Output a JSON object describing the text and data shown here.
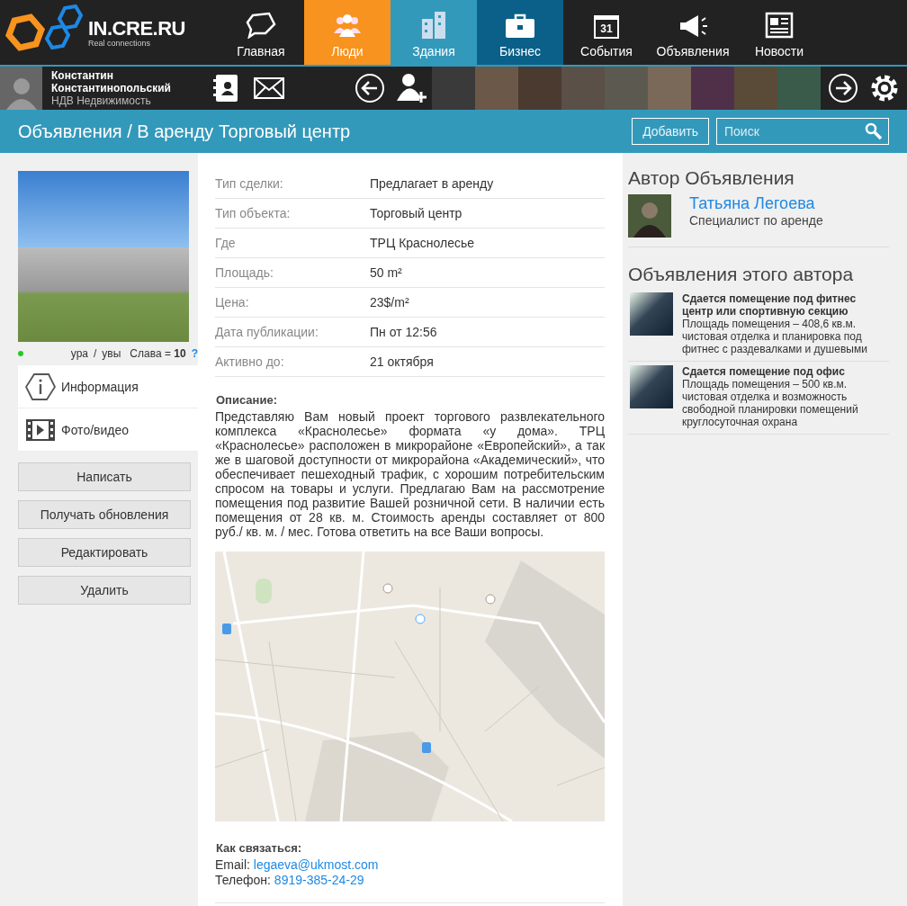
{
  "logo": {
    "name": "IN.CRE.RU",
    "tagline": "Real connections"
  },
  "nav": [
    {
      "label": "Главная",
      "kind": "chat"
    },
    {
      "label": "Люди",
      "kind": "people",
      "color": "#f7931e"
    },
    {
      "label": "Здания",
      "kind": "buildings",
      "color": "#3399bb"
    },
    {
      "label": "Бизнес",
      "kind": "briefcase",
      "color": "#0a6088"
    },
    {
      "label": "События",
      "kind": "calendar",
      "icon_text": "31"
    },
    {
      "label": "Объявления",
      "kind": "megaphone"
    },
    {
      "label": "Новости",
      "kind": "news"
    }
  ],
  "user": {
    "name": "Константин Константинопольский",
    "company": "НДВ Недвижимость"
  },
  "page_title": "Объявления / В аренду Торговый центр",
  "add_button": "Добавить",
  "search": {
    "placeholder": "Поиск"
  },
  "profile": {
    "online": true,
    "vote_up": "ура",
    "vote_separator": "/",
    "vote_down": "увы",
    "rating_label": "Слава =",
    "rating": "10",
    "help": "?"
  },
  "menu": [
    {
      "label": "Информация",
      "kind": "info"
    },
    {
      "label": "Фото/видео",
      "kind": "video"
    }
  ],
  "actions": [
    "Написать",
    "Получать обновления",
    "Редактировать",
    "Удалить"
  ],
  "details": [
    {
      "label": "Тип сделки:",
      "value": "Предлагает в аренду"
    },
    {
      "label": "Тип объекта:",
      "value": "Торговый центр"
    },
    {
      "label": "Где",
      "value": "ТРЦ Краснолесье"
    },
    {
      "label": "Площадь:",
      "value": "50 m²"
    },
    {
      "label": "Цена:",
      "value": "23$/m²"
    },
    {
      "label": "Дата публикации:",
      "value": "Пн от 12:56"
    },
    {
      "label": "Активно до:",
      "value": "21 октября"
    }
  ],
  "description": {
    "heading": "Описание:",
    "text": "Представляю Вам новый проект торгового развлекательного комплекса «Краснолесье» формата «у дома». ТРЦ «Краснолесье» расположен в микрорайоне «Европейский», а так же в шаговой доступности от микрорайона «Академический», что обеспечивает пешеходный трафик, с хорошим потребительским спросом на товары и услуги. Предлагаю Вам на рассмотрение помещения под развитие Вашей розничной сети. В наличии есть помещения от 28 кв. м. Стоимость аренды составляет от 800 руб./ кв. м. / мес. Готова ответить на все Ваши вопросы."
  },
  "contact": {
    "heading": "Как связаться:",
    "email_label": "Email:",
    "email": "legaeva@ukmost.com",
    "phone_label": "Телефон:",
    "phone": "8919-385-24-29"
  },
  "author": {
    "heading": "Автор Объявления",
    "name": "Татьяна Легоева",
    "role": "Специалист по аренде"
  },
  "author_listings": {
    "heading": "Объявления этого автора",
    "items": [
      {
        "title": "Сдается помещение под фитнес центр или спортивную секцию",
        "text": "Площадь помещения – 408,6 кв.м. чистовая отделка и планировка под фитнес с раздевалками и душевыми"
      },
      {
        "title": "Сдается помещение под офис",
        "text": "Площадь помещения – 500 кв.м. чистовая отделка и возможность свободной планировки помещений круглосуточная охрана"
      }
    ]
  }
}
